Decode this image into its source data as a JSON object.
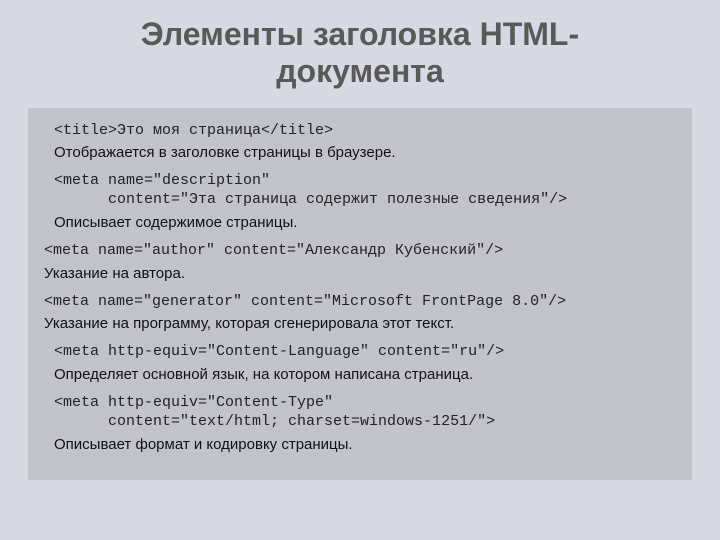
{
  "title_line1": "Элементы заголовка HTML-",
  "title_line2": "документа",
  "items": [
    {
      "code": "<title>Это моя страница</title>",
      "desc": "Отображается в заголовке страницы в браузере.",
      "pad": true
    },
    {
      "code": "<meta name=\"description\"\n      content=\"Эта страница содержит полезные сведения\"/>",
      "desc": "Описывает содержимое страницы.",
      "pad": true
    },
    {
      "code": "<meta name=\"author\" content=\"Александр Кубенский\"/>",
      "desc": "Указание на автора.",
      "pad": false
    },
    {
      "code": "<meta name=\"generator\" content=\"Microsoft FrontPage 8.0\"/>",
      "desc": "Указание на программу, которая сгенерировала этот текст.",
      "pad": false
    },
    {
      "code": "<meta http-equiv=\"Content-Language\" content=\"ru\"/>",
      "desc": "Определяет основной язык, на котором написана страница.",
      "pad": true
    },
    {
      "code": "<meta http-equiv=\"Content-Type\"\n      content=\"text/html; charset=windows-1251/\">",
      "desc": "Описывает формат и кодировку страницы.",
      "pad": true
    }
  ]
}
